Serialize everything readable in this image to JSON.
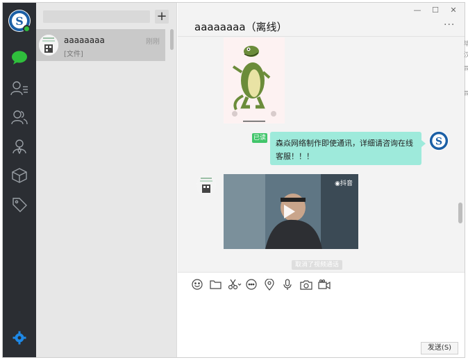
{
  "app": {
    "window_controls": {
      "minimize": "—",
      "maximize": "☐",
      "close": "✕"
    }
  },
  "nav": {
    "items": [
      {
        "icon": "chat-icon",
        "active": true
      },
      {
        "icon": "contacts-list-icon",
        "active": false
      },
      {
        "icon": "group-icon",
        "active": false
      },
      {
        "icon": "user-icon",
        "active": false
      },
      {
        "icon": "box-icon",
        "active": false
      },
      {
        "icon": "tag-icon",
        "active": false
      }
    ],
    "settings_icon": "gear-icon",
    "accent_color": "#2fbf3c",
    "settings_color": "#1e88e5"
  },
  "list": {
    "add_label": "+",
    "items": [
      {
        "name": "aaaaaaaa",
        "preview": "[文件]",
        "time": "刚刚"
      }
    ]
  },
  "chat": {
    "title": "aaaaaaaa（离线）",
    "more_label": "···",
    "messages": {
      "read_badge": "已读",
      "text_bubble": "森焱网络制作即使通讯，详细请咨询在线客服！！！",
      "video_logo": "◉抖音",
      "system_notice": "取消了视频通话"
    },
    "bubble_color": "#9eeadb"
  },
  "toolbar": {
    "tools": [
      "emoji-icon",
      "folder-icon",
      "scissors-icon",
      "chat-bubble-icon",
      "location-icon",
      "microphone-icon",
      "camera-icon",
      "video-camera-icon"
    ],
    "send_label": "发送(S)"
  },
  "stray_chars": [
    "毕",
    "汉",
    "司",
    "司"
  ]
}
